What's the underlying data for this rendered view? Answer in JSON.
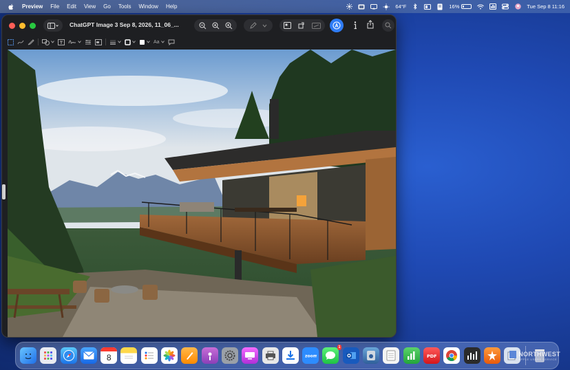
{
  "menubar": {
    "app_name": "Preview",
    "menus": [
      "File",
      "Edit",
      "View",
      "Go",
      "Tools",
      "Window",
      "Help"
    ],
    "weather": "64°F",
    "battery_percent": "16%",
    "battery_level": 0.16,
    "datetime": "Tue Sep 8  11:16"
  },
  "window": {
    "title": "ChatGPT Image 3 Sep 8, 2026, 11_06_...",
    "toolbar_icons": [
      "sidebar-icon",
      "zoom-out-icon",
      "zoom-in-icon",
      "zoom-fit-icon",
      "markup-pen-icon",
      "chevron-down-icon",
      "crop-icon",
      "rotate-icon",
      "redact-icon",
      "highlight-icon",
      "info-icon",
      "share-icon",
      "search-icon"
    ],
    "markup_font_label": "Aa"
  },
  "dock": {
    "calendar_day": "8",
    "messages_badge": "1"
  },
  "watermark": {
    "line1": "NORTHWEST",
    "line2": "APPLE USERS SERVICE"
  },
  "colors": {
    "desktop": "#1f49b3",
    "accent": "#2f7cf6",
    "window_bg": "#1e1f22"
  }
}
